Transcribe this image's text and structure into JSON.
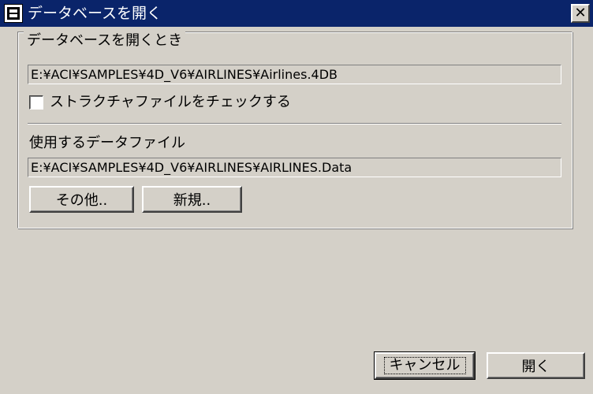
{
  "window": {
    "title": "データベースを開く",
    "close_label": "✕"
  },
  "group": {
    "legend": "データベースを開くとき",
    "structure_path": "E:¥ACI¥SAMPLES¥4D_V6¥AIRLINES¥Airlines.4DB",
    "check_structure_label": "ストラクチャファイルをチェックする",
    "check_structure_checked": false,
    "data_file_label": "使用するデータファイル",
    "data_path": "E:¥ACI¥SAMPLES¥4D_V6¥AIRLINES¥AIRLINES.Data",
    "other_button": "その他..",
    "new_button": "新規.."
  },
  "footer": {
    "cancel_button": "キャンセル",
    "open_button": "開く"
  }
}
